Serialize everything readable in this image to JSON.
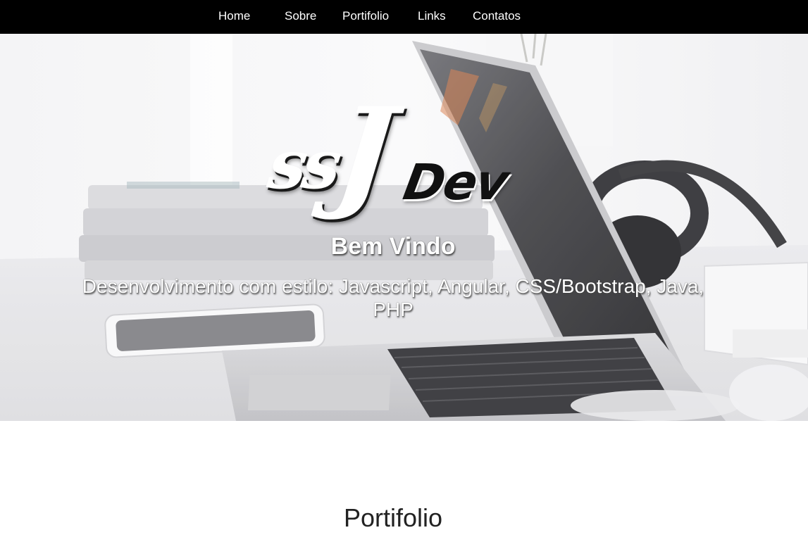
{
  "nav": {
    "items": [
      {
        "label": "Home"
      },
      {
        "label": "Sobre"
      },
      {
        "label": "Portifolio"
      },
      {
        "label": "Links"
      },
      {
        "label": "Contatos"
      }
    ]
  },
  "hero": {
    "logo": {
      "part1": "ss",
      "part2": "J",
      "part3": "Dev"
    },
    "welcome": "Bem Vindo",
    "subtitle": "Desenvolvimento com estilo: Javascript, Angular, CSS/Bootstrap, Java, PHP",
    "background_icon": "laptop-desk-photo"
  },
  "portfolio": {
    "title": "Portifolio"
  },
  "colors": {
    "nav_background": "#000000",
    "nav_text": "#ffffff",
    "hero_text": "#ffffff",
    "section_title": "#222222"
  }
}
